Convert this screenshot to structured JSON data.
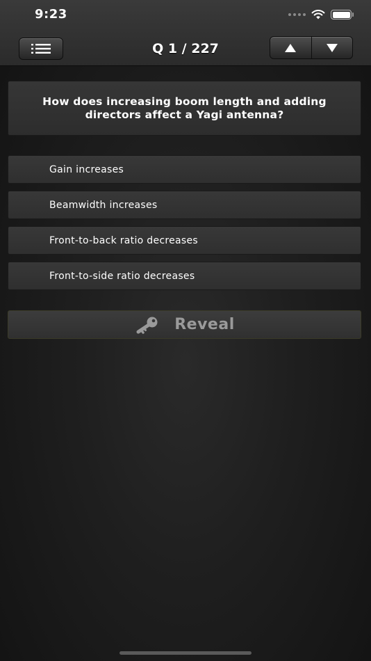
{
  "status_bar": {
    "time": "9:23"
  },
  "nav": {
    "title": "Q 1 / 227"
  },
  "question": {
    "text": "How does increasing boom length and adding directors affect a Yagi antenna?"
  },
  "answers": [
    "Gain increases",
    "Beamwidth increases",
    "Front-to-back ratio decreases",
    "Front-to-side ratio decreases"
  ],
  "reveal": {
    "label": "Reveal"
  }
}
